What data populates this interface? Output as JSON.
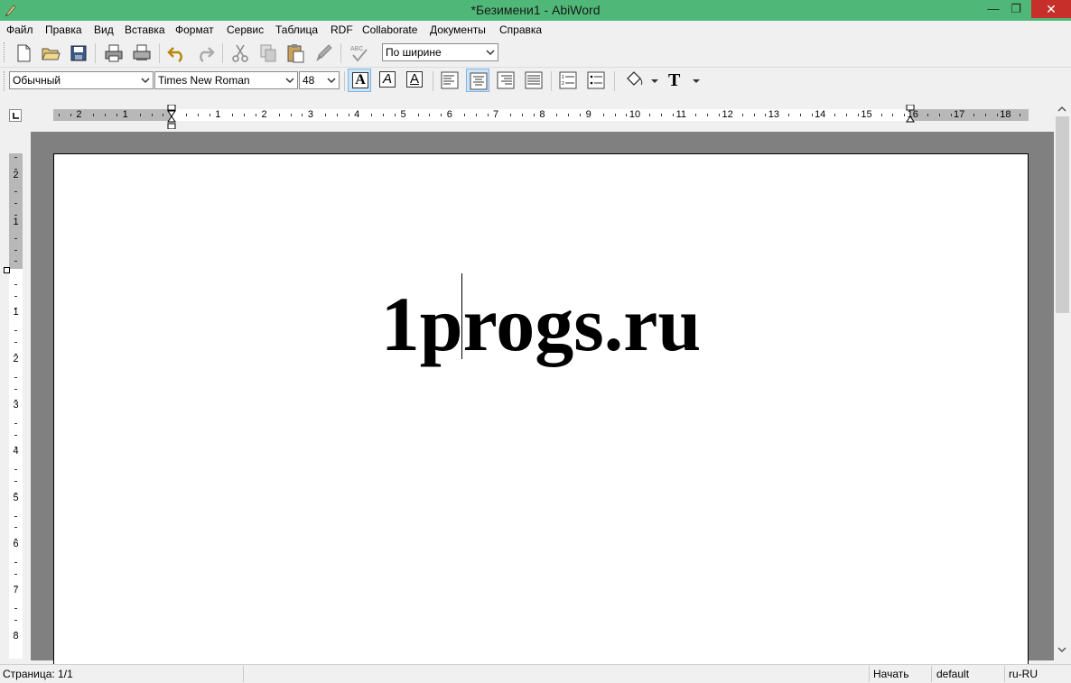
{
  "window": {
    "title": "*Безимени1 - AbiWord",
    "min_glyph": "—",
    "max_glyph": "❐",
    "close_glyph": "✕"
  },
  "menu": [
    {
      "label": "Файл"
    },
    {
      "label": "Правка"
    },
    {
      "label": "Вид"
    },
    {
      "label": "Вставка"
    },
    {
      "label": "Формат"
    },
    {
      "label": "Сервис"
    },
    {
      "label": "Таблица"
    },
    {
      "label": "RDF"
    },
    {
      "label": "Collaborate"
    },
    {
      "label": "Документы"
    },
    {
      "label": "Справка"
    }
  ],
  "toolbar": {
    "justify_combo": "По ширине",
    "style_combo": "Обычный",
    "font_combo": "Times New Roman",
    "size_combo": "48",
    "bold_glyph": "A",
    "italic_glyph": "A",
    "underline_glyph": "A",
    "text_tool_glyph": "T"
  },
  "ruler": {
    "h_left_labels": [
      "2",
      "1"
    ],
    "h_right_labels": [
      "1",
      "2",
      "3",
      "4",
      "5",
      "6",
      "7",
      "8",
      "9",
      "10",
      "11",
      "12",
      "13",
      "14",
      "15",
      "16",
      "17",
      "18"
    ],
    "v_top_labels": [
      "2",
      "1"
    ],
    "v_bottom_labels": [
      "1",
      "2",
      "3",
      "4",
      "5",
      "6",
      "7",
      "8"
    ]
  },
  "document": {
    "text": "1progs.ru"
  },
  "status": {
    "page": "Страница: 1/1",
    "mode": "Начать",
    "style": "default",
    "lang": "ru-RU"
  },
  "colors": {
    "titlebar": "#4fb878",
    "close": "#c7302a",
    "workspace": "#808080",
    "active_button": "#cce4f7"
  }
}
